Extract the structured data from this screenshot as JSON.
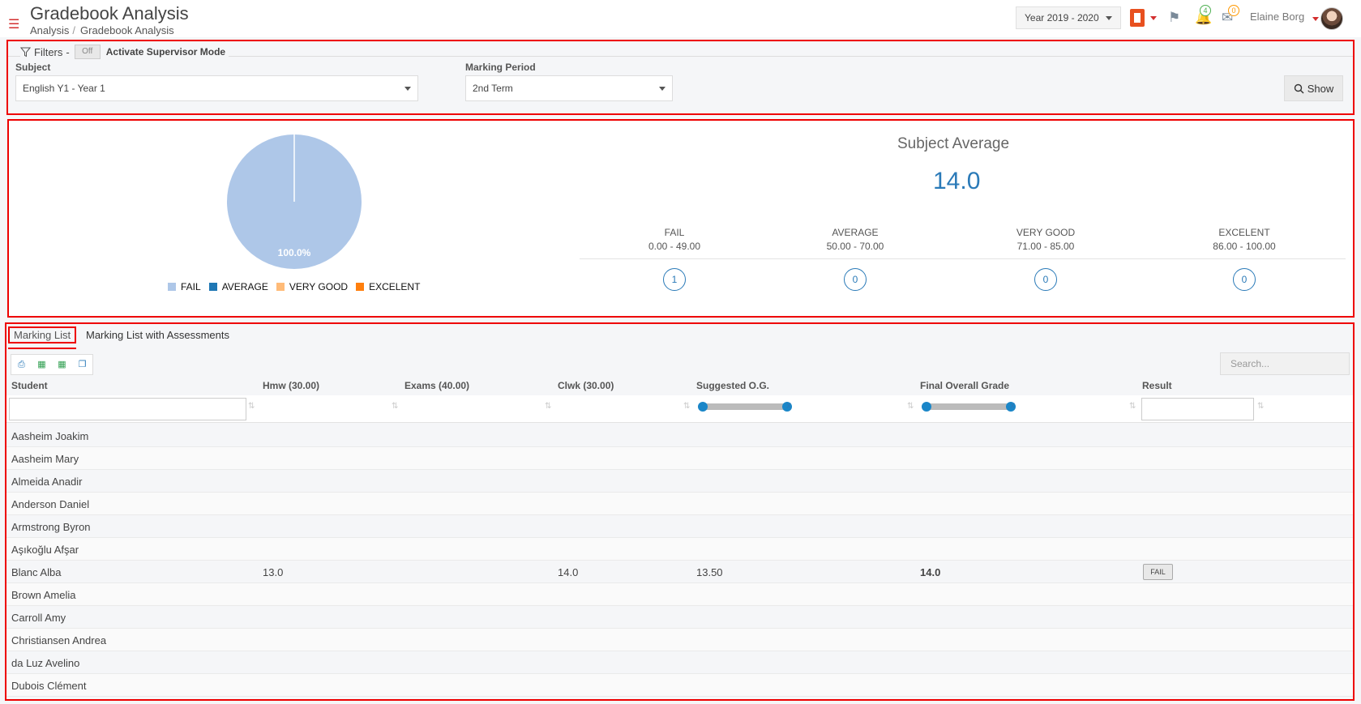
{
  "header": {
    "title": "Gradebook Analysis",
    "breadcrumb": [
      "Analysis",
      "Gradebook Analysis"
    ],
    "year": "Year 2019 - 2020",
    "notifications_count": "4",
    "messages_count": "0",
    "username": "Elaine Borg"
  },
  "filters": {
    "label": "Filters",
    "dash": "-",
    "toggle": "Off",
    "supervisor_label": "Activate Supervisor Mode",
    "subject_label": "Subject",
    "subject_value": "English Y1 - Year 1",
    "period_label": "Marking Period",
    "period_value": "2nd Term",
    "show_label": "Show"
  },
  "chart_data": {
    "type": "pie",
    "categories": [
      "FAIL",
      "AVERAGE",
      "VERY GOOD",
      "EXCELENT"
    ],
    "values": [
      100,
      0,
      0,
      0
    ],
    "slice_labels": [
      "100.0%"
    ],
    "colors": [
      "#aec7e8",
      "#1f77b4",
      "#ffbb78",
      "#ff7f0e"
    ],
    "legend_position": "bottom"
  },
  "summary": {
    "title": "Subject Average",
    "value": "14.0",
    "grades": [
      {
        "name": "FAIL",
        "range": "0.00 - 49.00",
        "count": "1"
      },
      {
        "name": "AVERAGE",
        "range": "50.00 - 70.00",
        "count": "0"
      },
      {
        "name": "VERY GOOD",
        "range": "71.00 - 85.00",
        "count": "0"
      },
      {
        "name": "EXCELENT",
        "range": "86.00 - 100.00",
        "count": "0"
      }
    ]
  },
  "tabs": [
    "Marking List",
    "Marking List with Assessments"
  ],
  "table": {
    "search_placeholder": "Search...",
    "columns": [
      "Student",
      "Hmw (30.00)",
      "Exams (40.00)",
      "Clwk (30.00)",
      "Suggested O.G.",
      "Final Overall Grade",
      "Result"
    ],
    "rows": [
      {
        "student": "Aasheim Joakim",
        "hmw": "",
        "exams": "",
        "clwk": "",
        "suggested": "",
        "final": "",
        "result": ""
      },
      {
        "student": "Aasheim Mary",
        "hmw": "",
        "exams": "",
        "clwk": "",
        "suggested": "",
        "final": "",
        "result": ""
      },
      {
        "student": "Almeida Anadir",
        "hmw": "",
        "exams": "",
        "clwk": "",
        "suggested": "",
        "final": "",
        "result": ""
      },
      {
        "student": "Anderson Daniel",
        "hmw": "",
        "exams": "",
        "clwk": "",
        "suggested": "",
        "final": "",
        "result": ""
      },
      {
        "student": "Armstrong Byron",
        "hmw": "",
        "exams": "",
        "clwk": "",
        "suggested": "",
        "final": "",
        "result": ""
      },
      {
        "student": "Aşıkoğlu Afşar",
        "hmw": "",
        "exams": "",
        "clwk": "",
        "suggested": "",
        "final": "",
        "result": ""
      },
      {
        "student": "Blanc Alba",
        "hmw": "13.0",
        "exams": "",
        "clwk": "14.0",
        "suggested": "13.50",
        "final": "14.0",
        "result": "FAIL"
      },
      {
        "student": "Brown Amelia",
        "hmw": "",
        "exams": "",
        "clwk": "",
        "suggested": "",
        "final": "",
        "result": ""
      },
      {
        "student": "Carroll Amy",
        "hmw": "",
        "exams": "",
        "clwk": "",
        "suggested": "",
        "final": "",
        "result": ""
      },
      {
        "student": "Christiansen Andrea",
        "hmw": "",
        "exams": "",
        "clwk": "",
        "suggested": "",
        "final": "",
        "result": ""
      },
      {
        "student": "da Luz Avelino",
        "hmw": "",
        "exams": "",
        "clwk": "",
        "suggested": "",
        "final": "",
        "result": ""
      },
      {
        "student": "Dubois Clément",
        "hmw": "",
        "exams": "",
        "clwk": "",
        "suggested": "",
        "final": "",
        "result": ""
      }
    ]
  }
}
